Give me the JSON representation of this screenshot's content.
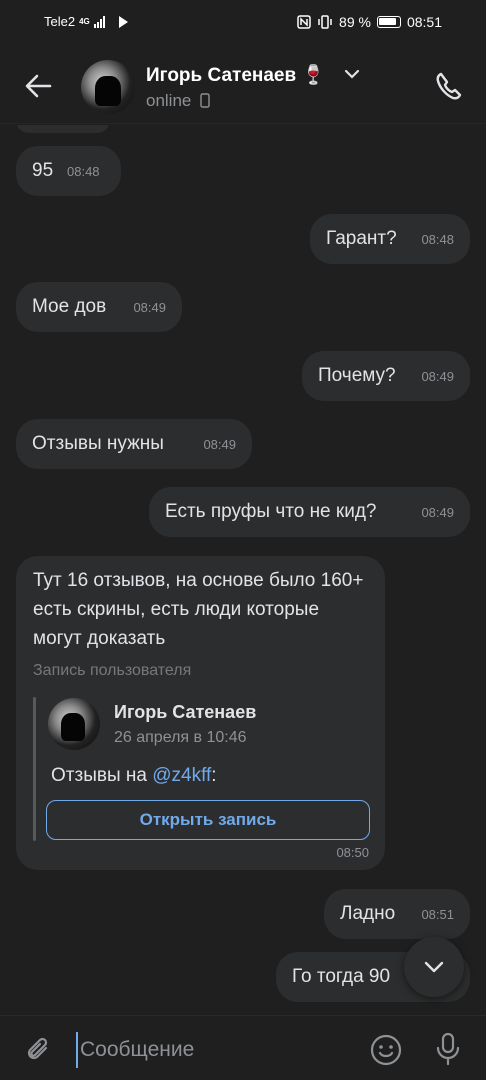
{
  "status_bar": {
    "carrier": "Tele2",
    "network": "4G",
    "battery": "89 %",
    "time": "08:51"
  },
  "header": {
    "name": "Игорь Сатенаев 🍷",
    "status": "online"
  },
  "messages": [
    {
      "dir": "in",
      "text": "95",
      "time": "08:48"
    },
    {
      "dir": "out",
      "text": "Гарант?",
      "time": "08:48"
    },
    {
      "dir": "in",
      "text": "Мое дов",
      "time": "08:49"
    },
    {
      "dir": "out",
      "text": "Почему?",
      "time": "08:49"
    },
    {
      "dir": "in",
      "text": "Отзывы нужны",
      "time": "08:49"
    },
    {
      "dir": "out",
      "text": "Есть пруфы что не кид?",
      "time": "08:49"
    },
    {
      "dir": "out",
      "text": "Ладно",
      "time": "08:51"
    },
    {
      "dir": "out",
      "text": "Го тогда 90",
      "time": ""
    }
  ],
  "post_message": {
    "text": "Тут 16 отзывов, на основе было 160+ есть скрины, есть люди которые могут доказать",
    "subtitle": "Запись пользователя",
    "author": "Игорь Сатенаев",
    "date": "26 апреля в 10:46",
    "body_prefix": "Отзывы на ",
    "mention": "@z4kff",
    "body_suffix": ":",
    "button": "Открыть запись",
    "time": "08:50"
  },
  "composer": {
    "placeholder": "Сообщение"
  },
  "colors": {
    "background": "#1f1f1f",
    "bubble": "#2c2d2e",
    "accent": "#71aaeb"
  },
  "icons": [
    "back-arrow-icon",
    "chevron-down-icon",
    "phone-icon",
    "attach-icon",
    "emoji-icon",
    "mic-icon",
    "arrow-down-icon"
  ]
}
